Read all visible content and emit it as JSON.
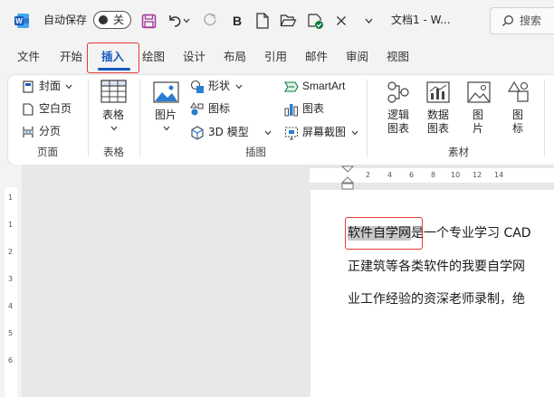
{
  "titlebar": {
    "app_icon": "word-icon",
    "autosave_label": "自动保存",
    "autosave_state": "关",
    "icons": [
      "save-icon",
      "undo-icon",
      "undo-dropdown-icon",
      "redo-icon",
      "bold-icon",
      "new-file-icon",
      "open-folder-icon",
      "check-file-icon",
      "close-icon",
      "dropdown-icon"
    ],
    "bold_glyph": "B",
    "document_title": "文档1  -  W...",
    "search_placeholder": "搜索"
  },
  "tabs": [
    {
      "label": "文件"
    },
    {
      "label": "开始"
    },
    {
      "label": "插入",
      "active": true
    },
    {
      "label": "绘图"
    },
    {
      "label": "设计"
    },
    {
      "label": "布局"
    },
    {
      "label": "引用"
    },
    {
      "label": "邮件"
    },
    {
      "label": "审阅"
    },
    {
      "label": "视图"
    }
  ],
  "ribbon": {
    "pages_group": {
      "label": "页面",
      "items": [
        "封面",
        "空白页",
        "分页"
      ]
    },
    "tables_group": {
      "label": "表格",
      "items": [
        "表格"
      ]
    },
    "illustrations_group": {
      "label": "插图",
      "items": [
        "图片",
        "形状",
        "图标",
        "3D 模型",
        "SmartArt",
        "图表",
        "屏幕截图"
      ]
    },
    "materials_group": {
      "label": "素材",
      "items": [
        {
          "line1": "逻辑",
          "line2": "图表"
        },
        {
          "line1": "数据",
          "line2": "图表"
        },
        {
          "line1": "图",
          "line2": "片"
        },
        {
          "line1": "图",
          "line2": "标"
        }
      ]
    }
  },
  "ruler": {
    "horizontal_ticks": [
      "2",
      "4",
      "6",
      "8",
      "10",
      "12",
      "14"
    ],
    "vertical_ticks": [
      "1",
      "1",
      "2",
      "3",
      "4",
      "5",
      "6"
    ]
  },
  "document": {
    "line1_selected": "软件自学网",
    "line1_rest": "是一个专业学习 CAD",
    "line2": "正建筑等各类软件的我要自学网",
    "line3": "业工作经验的资深老师录制，绝"
  },
  "colors": {
    "accent_blue": "#185abd",
    "highlight_red": "#e53935",
    "save_purple": "#a63fa0",
    "selection_gray": "#c8c8c8"
  }
}
